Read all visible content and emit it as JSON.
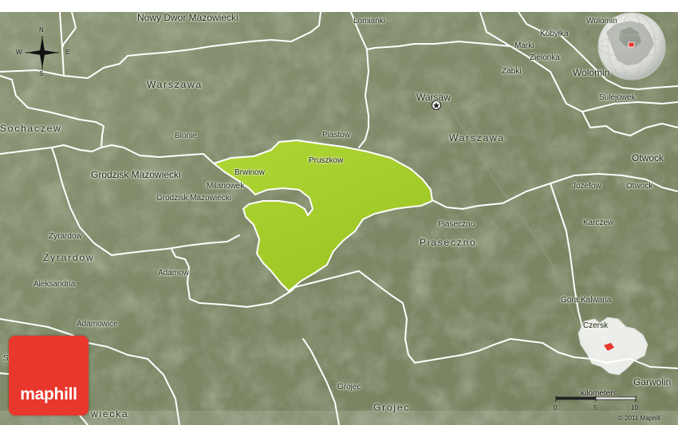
{
  "map": {
    "labels": [
      {
        "id": "nowy-dwor",
        "text": "Nowy Dwor Mazowiecki",
        "size": "md"
      },
      {
        "id": "lomianki",
        "text": "Lomianki",
        "size": "sm"
      },
      {
        "id": "marki",
        "text": "Marki",
        "size": "sm"
      },
      {
        "id": "kobylka",
        "text": "Kobyłka",
        "size": "sm"
      },
      {
        "id": "zielonka",
        "text": "Zielonka",
        "size": "sm"
      },
      {
        "id": "zabki",
        "text": "Zabki",
        "size": "sm"
      },
      {
        "id": "wolomin-top",
        "text": "Wolomin",
        "size": "sm"
      },
      {
        "id": "wolomin",
        "text": "Wolomin",
        "size": "md"
      },
      {
        "id": "sulejowek",
        "text": "Sulejowek",
        "size": "sm"
      },
      {
        "id": "warszawa-l",
        "text": "Warszawa",
        "size": "big"
      },
      {
        "id": "warsaw",
        "text": "Warsaw",
        "size": "md"
      },
      {
        "id": "warszawa",
        "text": "Warszawa",
        "size": "big"
      },
      {
        "id": "sochaczew",
        "text": "Sochaczew",
        "size": "big"
      },
      {
        "id": "blonie",
        "text": "Blonie",
        "size": "sm"
      },
      {
        "id": "piastow",
        "text": "Piastow",
        "size": "sm"
      },
      {
        "id": "brwinow",
        "text": "Brwinow",
        "size": "sm"
      },
      {
        "id": "pruszkow",
        "text": "Pruszkow",
        "size": "sm"
      },
      {
        "id": "grodzisk-big",
        "text": "Grodzisk Mazowiecki",
        "size": "md"
      },
      {
        "id": "milanowek",
        "text": "Milanowek",
        "size": "sm"
      },
      {
        "id": "grodzisk-sm",
        "text": "Grodzisk Mazowiecki",
        "size": "sm"
      },
      {
        "id": "otwock-md",
        "text": "Otwock",
        "size": "md"
      },
      {
        "id": "jozefow",
        "text": "Jozefow",
        "size": "sm"
      },
      {
        "id": "otwock-sm",
        "text": "Otwock",
        "size": "sm"
      },
      {
        "id": "piaseczno-sm",
        "text": "Piaseczno",
        "size": "sm"
      },
      {
        "id": "piaseczno",
        "text": "Piaseczno",
        "size": "big"
      },
      {
        "id": "karczew",
        "text": "Karczew",
        "size": "sm"
      },
      {
        "id": "zyrardow-sm",
        "text": "Zyrardow",
        "size": "sm"
      },
      {
        "id": "zyrardow",
        "text": "Zyrardow",
        "size": "big"
      },
      {
        "id": "adamow",
        "text": "Adamow",
        "size": "sm"
      },
      {
        "id": "aleksandria",
        "text": "Aleksandria",
        "size": "sm"
      },
      {
        "id": "adamowice",
        "text": "Adamowice",
        "size": "sm"
      },
      {
        "id": "gora-kalwaria",
        "text": "Gora Kalwaria",
        "size": "sm"
      },
      {
        "id": "czersk",
        "text": "Czersk",
        "size": "sm"
      },
      {
        "id": "garwolin",
        "text": "Garwolin",
        "size": "md"
      },
      {
        "id": "grojec-sm",
        "text": "Grojec",
        "size": "sm"
      },
      {
        "id": "grojec",
        "text": "Grojec",
        "size": "big"
      },
      {
        "id": "wiecka",
        "text": "wiecka",
        "size": "big"
      },
      {
        "id": "s-edge",
        "text": "S",
        "size": "sm"
      }
    ],
    "compass": {
      "n": "N",
      "s": "S",
      "w": "W",
      "e": "E"
    },
    "scale": {
      "label": "kilometers",
      "ticks": [
        "0",
        "5",
        "10"
      ]
    },
    "brand": "maphill",
    "copyright": "© 2011 Maphill",
    "colors": {
      "terrain": "#7f8b6b",
      "highlight": "#a7d12c",
      "border": "#ffffff",
      "brand": "#e8372c"
    }
  }
}
